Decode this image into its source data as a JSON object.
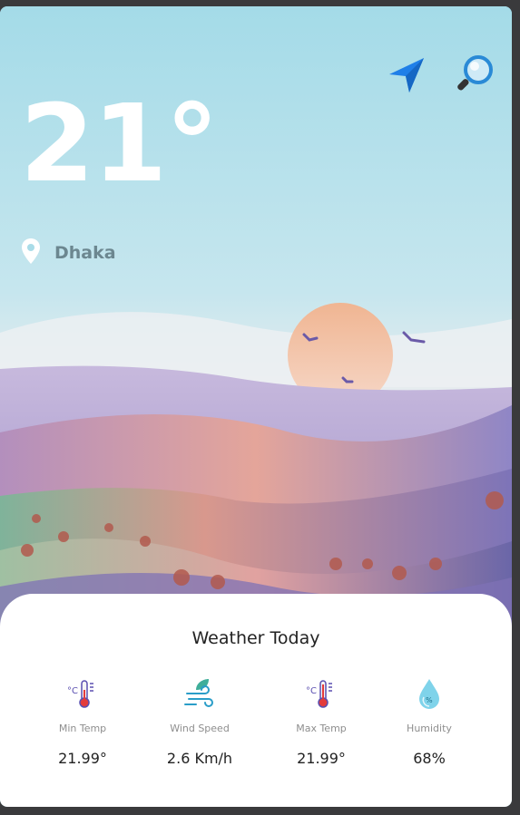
{
  "header": {
    "temperature": "21°",
    "location": "Dhaka"
  },
  "icons": {
    "navigate": "navigation-arrow-icon",
    "search": "magnifier-icon",
    "location": "location-pin-icon"
  },
  "card": {
    "title": "Weather Today",
    "stats": [
      {
        "icon": "thermometer-cold-icon",
        "label": "Min Temp",
        "value": "21.99°"
      },
      {
        "icon": "wind-leaf-icon",
        "label": "Wind Speed",
        "value": "2.6 Km/h"
      },
      {
        "icon": "thermometer-hot-icon",
        "label": "Max Temp",
        "value": "21.99°"
      },
      {
        "icon": "humidity-drop-icon",
        "label": "Humidity",
        "value": "68%"
      }
    ]
  },
  "colors": {
    "sky": "#a9dce8",
    "accent_blue": "#1f7fe8",
    "pin_gray": "#6c8790"
  }
}
